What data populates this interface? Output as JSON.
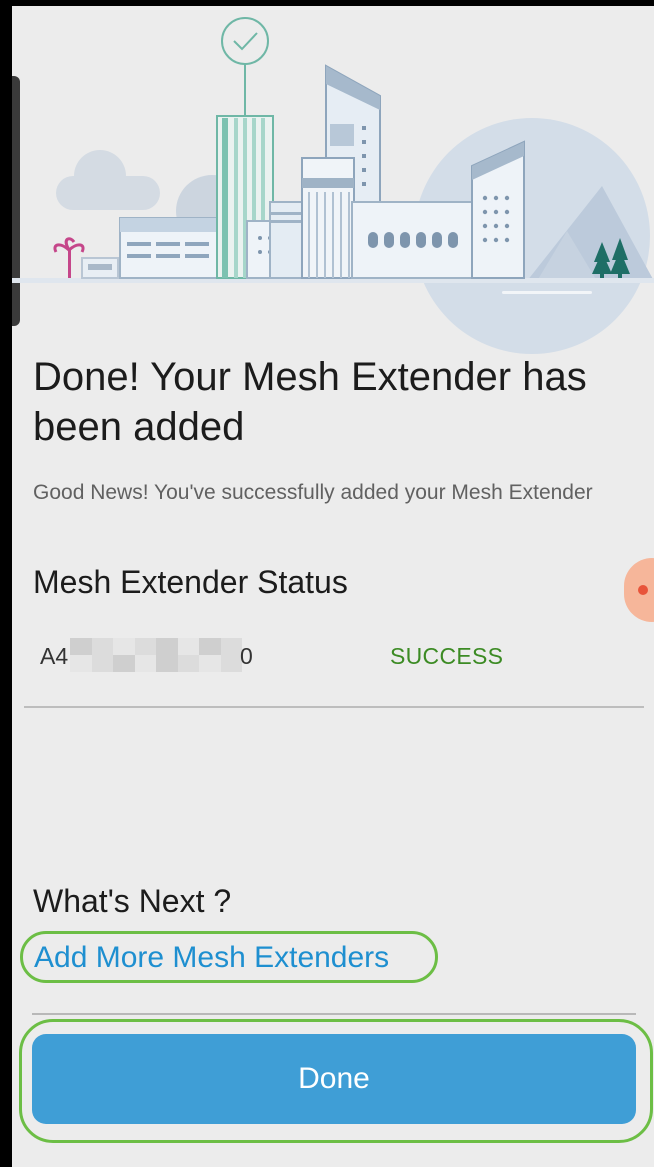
{
  "header": {
    "title": "Done! Your Mesh Extender has been added",
    "subtitle": "Good News! You've successfully added your Mesh Extender"
  },
  "status": {
    "heading": "Mesh Extender Status",
    "device_id_start": "A4",
    "device_id_end": "0",
    "value": "SUCCESS"
  },
  "next": {
    "heading": "What's Next ?",
    "add_more_label": "Add More Mesh Extenders"
  },
  "actions": {
    "done_label": "Done"
  },
  "colors": {
    "accent": "#3f9ed6",
    "link": "#1e8fd0",
    "success": "#3c8b24",
    "highlight": "#6cbe45"
  }
}
